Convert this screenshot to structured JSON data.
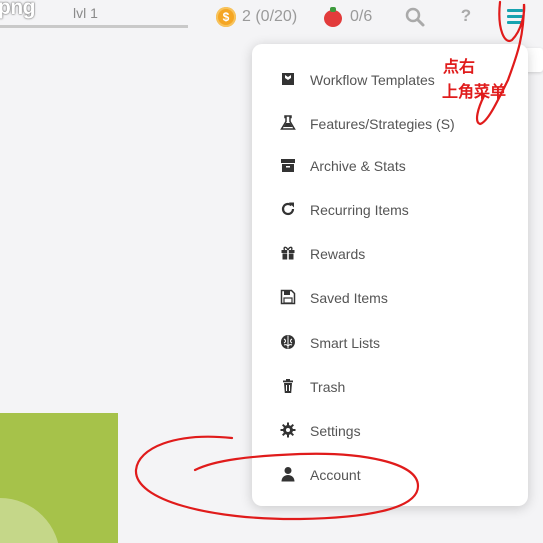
{
  "header": {
    "cut_label": "png",
    "level": "lvl 1",
    "coin_symbol": "$",
    "coins": "2 (0/20)",
    "tomatoes": "0/6",
    "help": "?",
    "menu_tooltip": "Menu"
  },
  "menu": {
    "items": [
      {
        "label": "Workflow Templates",
        "icon": "template-icon"
      },
      {
        "label": "Features/Strategies (S)",
        "icon": "flask-icon"
      },
      {
        "label": "Archive & Stats",
        "icon": "archive-icon"
      },
      {
        "label": "Recurring Items",
        "icon": "refresh-icon"
      },
      {
        "label": "Rewards",
        "icon": "gift-icon"
      },
      {
        "label": "Saved Items",
        "icon": "floppy-icon"
      },
      {
        "label": "Smart Lists",
        "icon": "brain-icon"
      },
      {
        "label": "Trash",
        "icon": "trash-icon"
      },
      {
        "label": "Settings",
        "icon": "gear-icon"
      },
      {
        "label": "Account",
        "icon": "user-icon"
      }
    ]
  },
  "annotation": {
    "line1": "点右",
    "line2": "上角菜单"
  },
  "colors": {
    "accent": "#17a3b0",
    "coin": "#f5a623",
    "tomato": "#e23b3b",
    "annotation": "#e01b1b",
    "green_panel": "#a6c24a"
  }
}
